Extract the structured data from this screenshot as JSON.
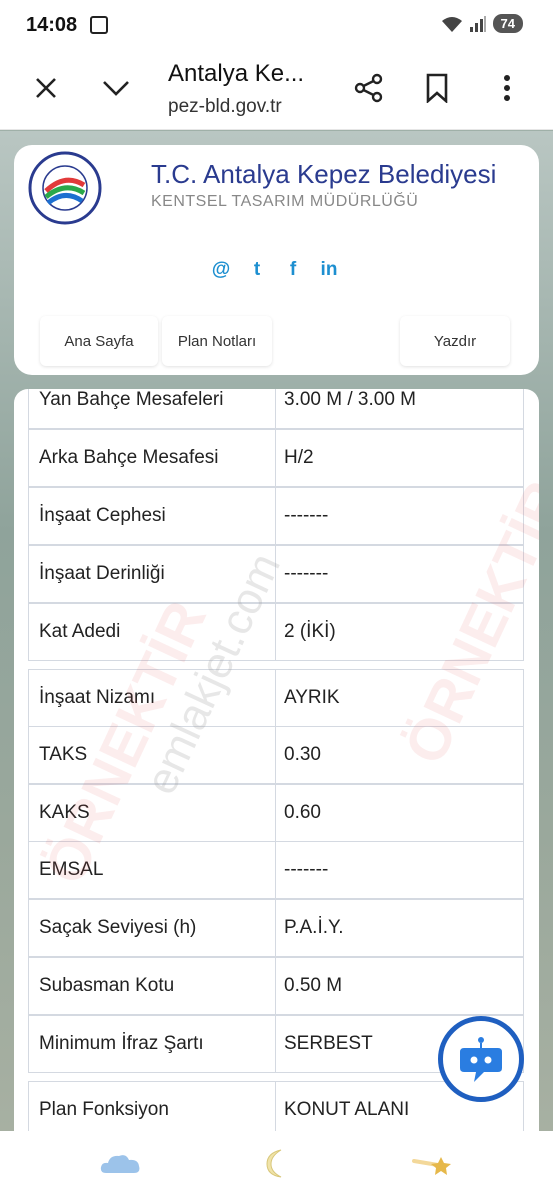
{
  "status": {
    "time": "14:08",
    "battery": "74",
    "wifi_badge": "6"
  },
  "browser": {
    "title": "Antalya Ke...",
    "url": "pez-bld.gov.tr"
  },
  "header": {
    "title": "T.C. Antalya Kepez Belediyesi",
    "subtitle": "KENTSEL TASARIM MÜDÜRLÜĞÜ",
    "logo_text": "KEPEZ BELEDİYESİ",
    "social": [
      "@",
      "t",
      "f",
      "in"
    ],
    "nav": [
      "Ana Sayfa",
      "Plan Notları",
      "Yazdır"
    ]
  },
  "rows": [
    {
      "label": "Yan Bahçe Mesafeleri",
      "value": "3.00 M / 3.00 M"
    },
    {
      "label": "Arka Bahçe Mesafesi",
      "value": "H/2"
    },
    {
      "label": "İnşaat Cephesi",
      "value": "-------"
    },
    {
      "label": "İnşaat Derinliği",
      "value": "-------"
    },
    {
      "label": "Kat Adedi",
      "value": "2 (İKİ)"
    },
    {
      "label": "İnşaat Nizamı",
      "value": "AYRIK"
    },
    {
      "label": "TAKS",
      "value": "0.30"
    },
    {
      "label": "KAKS",
      "value": "0.60"
    },
    {
      "label": "EMSAL",
      "value": "-------"
    },
    {
      "label": "Saçak Seviyesi (h)",
      "value": "P.A.İ.Y."
    },
    {
      "label": "Subasman Kotu",
      "value": "0.50 M"
    },
    {
      "label": "Minimum İfraz Şartı",
      "value": "SERBEST"
    },
    {
      "label": "Plan Fonksiyon",
      "value": "KONUT ALANI"
    }
  ],
  "watermarks": {
    "main": "ÖRNEKTİR",
    "site": "emlakjet.com"
  },
  "colors": {
    "brand_blue": "#2a3b8f",
    "social_blue": "#1d8fd0",
    "fab_blue": "#1f5fc0"
  }
}
